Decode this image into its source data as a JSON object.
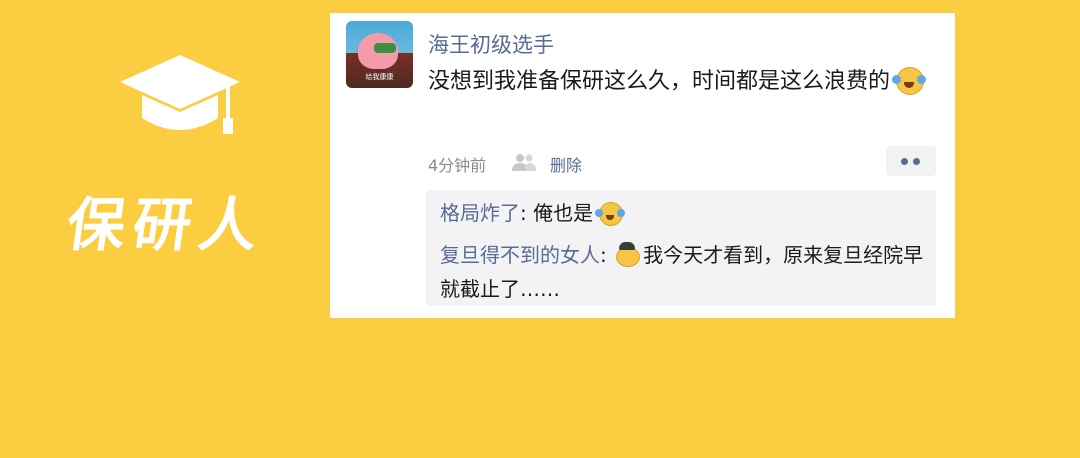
{
  "brand": {
    "title": "保研人",
    "icon": "graduation-cap-icon"
  },
  "post": {
    "avatar_caption": "给我康康",
    "username": "海王初级选手",
    "text": "没想到我准备保研这么久，时间都是这么浪费的",
    "timestamp": "4分钟前",
    "delete_label": "删除",
    "more_icon": "more-dots-icon"
  },
  "comments": [
    {
      "author": "格局炸了",
      "separator": ": ",
      "text": "俺也是"
    },
    {
      "author": "复旦得不到的女人",
      "separator": ": ",
      "text": "我今天才看到，原来复旦经院早就截止了……"
    }
  ],
  "colors": {
    "background": "#FBCE42",
    "link": "#576B95",
    "card": "#FFFFFF",
    "comment_bg": "#F3F3F5"
  }
}
